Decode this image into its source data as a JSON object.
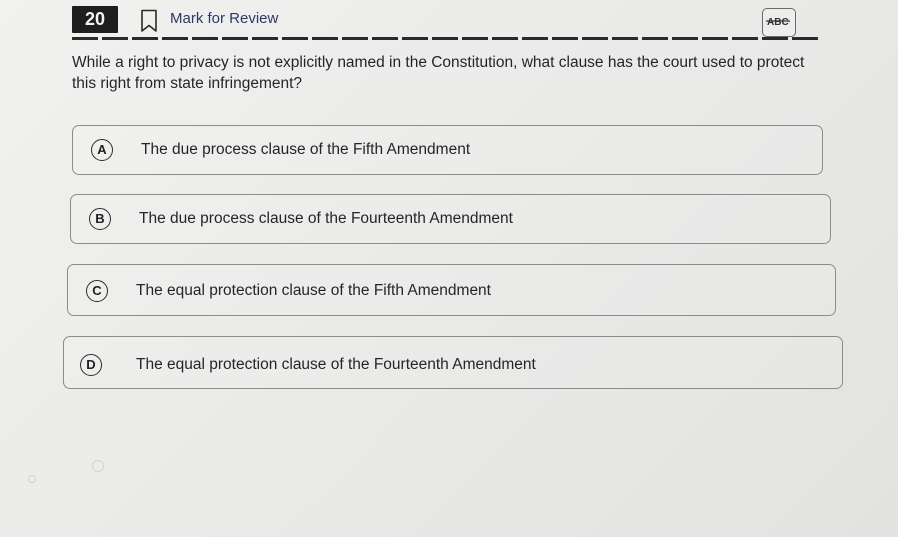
{
  "header": {
    "question_number": "20",
    "mark_for_review_label": "Mark for Review",
    "abc_icon": "abc-strikethrough-icon"
  },
  "question": {
    "text": "While a right to privacy is not explicitly named in the Constitution, what clause has the court used to protect this right from state infringement?"
  },
  "options": [
    {
      "letter": "A",
      "text": "The due process clause of the Fifth Amendment"
    },
    {
      "letter": "B",
      "text": "The due process clause of the Fourteenth Amendment"
    },
    {
      "letter": "C",
      "text": "The equal protection clause of the Fifth Amendment"
    },
    {
      "letter": "D",
      "text": "The equal protection clause of the Fourteenth Amendment"
    }
  ],
  "colors": {
    "background": "#ececea",
    "question_badge": "#1e1e1e",
    "mark_label": "#2b3a67",
    "option_border": "#8c8c8c"
  }
}
